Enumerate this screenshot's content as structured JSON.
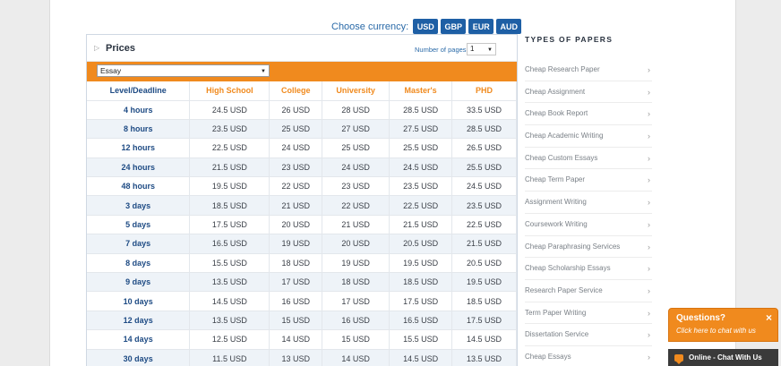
{
  "currency": {
    "label": "Choose currency:",
    "options": [
      "USD",
      "GBP",
      "EUR",
      "AUD"
    ],
    "selected": "USD"
  },
  "prices": {
    "title": "Prices",
    "pages_label": "Number of pages:",
    "pages_value": "1",
    "paper_type": "Essay",
    "columns": [
      "Level/Deadline",
      "High School",
      "College",
      "University",
      "Master's",
      "PHD"
    ],
    "rows": [
      [
        "4 hours",
        "24.5 USD",
        "26 USD",
        "28 USD",
        "28.5 USD",
        "33.5 USD"
      ],
      [
        "8 hours",
        "23.5 USD",
        "25 USD",
        "27 USD",
        "27.5 USD",
        "28.5 USD"
      ],
      [
        "12 hours",
        "22.5 USD",
        "24 USD",
        "25 USD",
        "25.5 USD",
        "26.5 USD"
      ],
      [
        "24 hours",
        "21.5 USD",
        "23 USD",
        "24 USD",
        "24.5 USD",
        "25.5 USD"
      ],
      [
        "48 hours",
        "19.5 USD",
        "22 USD",
        "23 USD",
        "23.5 USD",
        "24.5 USD"
      ],
      [
        "3 days",
        "18.5 USD",
        "21 USD",
        "22 USD",
        "22.5 USD",
        "23.5 USD"
      ],
      [
        "5 days",
        "17.5 USD",
        "20 USD",
        "21 USD",
        "21.5 USD",
        "22.5 USD"
      ],
      [
        "7 days",
        "16.5 USD",
        "19 USD",
        "20 USD",
        "20.5 USD",
        "21.5 USD"
      ],
      [
        "8 days",
        "15.5 USD",
        "18 USD",
        "19 USD",
        "19.5 USD",
        "20.5 USD"
      ],
      [
        "9 days",
        "13.5 USD",
        "17 USD",
        "18 USD",
        "18.5 USD",
        "19.5 USD"
      ],
      [
        "10 days",
        "14.5 USD",
        "16 USD",
        "17 USD",
        "17.5 USD",
        "18.5 USD"
      ],
      [
        "12 days",
        "13.5 USD",
        "15 USD",
        "16 USD",
        "16.5 USD",
        "17.5 USD"
      ],
      [
        "14 days",
        "12.5 USD",
        "14 USD",
        "15 USD",
        "15.5 USD",
        "14.5 USD"
      ],
      [
        "30 days",
        "11.5 USD",
        "13 USD",
        "14 USD",
        "14.5 USD",
        "13.5 USD"
      ]
    ]
  },
  "sidebar": {
    "title": "TYPES OF PAPERS",
    "items": [
      "Cheap Research Paper",
      "Cheap Assignment",
      "Cheap Book Report",
      "Cheap Academic Writing",
      "Cheap Custom Essays",
      "Cheap Term Paper",
      "Assignment Writing",
      "Coursework Writing",
      "Cheap Paraphrasing Services",
      "Cheap Scholarship Essays",
      "Research Paper Service",
      "Term Paper Writing",
      "Dissertation Service",
      "Cheap Essays"
    ]
  },
  "chat": {
    "title": "Questions?",
    "close": "×",
    "subtitle": "Click here to chat with us",
    "status": "Online - Chat With Us"
  },
  "icons": {
    "panel": "triangle-right-icon",
    "dropdown": "caret-down-icon",
    "sidebar_item": "chevron-right-icon",
    "chat": "chat-bubble-icon"
  },
  "colors": {
    "brand_orange": "#f08a1e",
    "brand_blue": "#1e5fa5",
    "level_blue": "#1e4b84"
  }
}
